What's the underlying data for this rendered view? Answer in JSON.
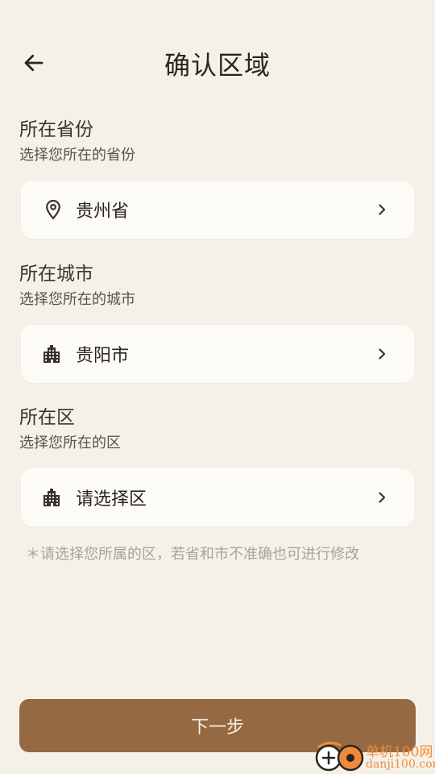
{
  "header": {
    "title": "确认区域",
    "back_icon": "arrow-left-icon"
  },
  "province": {
    "title": "所在省份",
    "subtitle": "选择您所在的省份",
    "value": "贵州省",
    "icon": "location-pin-icon"
  },
  "city": {
    "title": "所在城市",
    "subtitle": "选择您所在的城市",
    "value": "贵阳市",
    "icon": "building-icon"
  },
  "district": {
    "title": "所在区",
    "subtitle": "选择您所在的区",
    "value": "请选择区",
    "icon": "building-icon"
  },
  "hint": "＊请选择您所属的区，若省和市不准确也可进行修改",
  "next_button": "下一步",
  "watermark": {
    "cn": "单机100网",
    "en": "danji100.com"
  },
  "colors": {
    "background": "#f5f1e8",
    "card": "#fdfbf5",
    "primary_button": "#956a43",
    "hint_text": "#a8a29a",
    "watermark": "#f08a3a"
  }
}
